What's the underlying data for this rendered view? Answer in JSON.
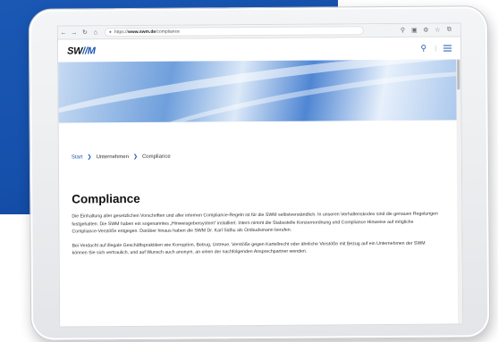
{
  "browser": {
    "url_prefix": "https://",
    "url_domain": "www.swm.de",
    "url_path": "/compliance"
  },
  "site": {
    "logo": "SW",
    "logo_accent": "//M"
  },
  "breadcrumb": {
    "items": [
      "Start",
      "Unternehmen",
      "Compliance"
    ]
  },
  "page": {
    "title": "Compliance",
    "paragraphs": [
      "Die Einhaltung aller gesetzlichen Vorschriften und aller internen Compliance-Regeln ist für die SWM selbstverständlich. In unseren Verhaltenskodex sind die genauen Regelungen festgehalten. Die SWM haben ein sogenanntes „Hinweisgebersystem“ installiert. Intern nimmt die Stabsstelle Konzernordnung und Compliance Hinweise auf mögliche Compliance-Verstöße entgegen. Darüber hinaus haben die SWM Dr. Karl Sidhu als Ombudsmann berufen.",
      "Bei Verdacht auf illegale Geschäftspraktiken wie Korruption, Betrug, Untreue, Verstöße gegen Kartellrecht oder ähnliche Verstöße mit Bezug auf ein Unternehmen der SWM können Sie sich vertraulich, und auf Wunsch auch anonym, an einen der nachfolgenden Ansprechpartner wenden."
    ]
  },
  "colors": {
    "brand_blue": "#1a56b0",
    "background_blue": "#1550ab"
  },
  "icons": {
    "back": "arrow-left-icon",
    "forward": "arrow-right-icon",
    "reload": "reload-icon",
    "home": "home-icon",
    "search": "search-icon",
    "menu": "hamburger-menu-icon"
  }
}
